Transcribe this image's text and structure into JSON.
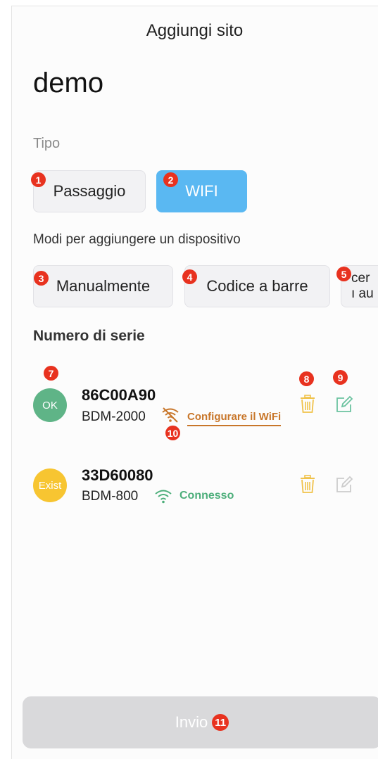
{
  "header": {
    "title": "Aggiungi sito"
  },
  "site": {
    "name": "demo"
  },
  "type_section": {
    "label": "Tipo",
    "options": [
      {
        "label": "Passaggio",
        "selected": false,
        "badge": "1"
      },
      {
        "label": "WIFI",
        "selected": true,
        "badge": "2"
      }
    ]
  },
  "add_methods": {
    "label": "Modi per aggiungere un dispositivo",
    "options": [
      {
        "label": "Manualmente",
        "badge": "3"
      },
      {
        "label": "Codice a barre",
        "badge": "4"
      },
      {
        "label_line1": "cer",
        "label_line2": "ı au",
        "badge": "5"
      }
    ]
  },
  "serial_section": {
    "label": "Numero di serie"
  },
  "devices": [
    {
      "status": "OK",
      "status_color": "#5fb487",
      "serial": "86C00A90",
      "model": "BDM-2000",
      "wifi_state": "disconnected",
      "wifi_text": "Configurare il WiFi",
      "badges": {
        "status": "7",
        "delete": "8",
        "edit": "9",
        "wifi": "10"
      }
    },
    {
      "status": "Exist",
      "status_color": "#f7c531",
      "serial": "33D60080",
      "model": "BDM-800",
      "wifi_state": "connected",
      "wifi_text": "Connesso"
    }
  ],
  "submit": {
    "label": "Invio",
    "badge": "11"
  },
  "colors": {
    "accent": "#5ab8f2",
    "badge": "#e8321f",
    "delete_icon": "#f0c24a",
    "edit_icon_active": "#6cc3a0",
    "edit_icon_disabled": "#cccccc",
    "warning": "#c8762a",
    "success": "#4cae7a"
  },
  "icons": [
    "delete-icon",
    "edit-icon",
    "wifi-off-icon",
    "wifi-icon"
  ]
}
